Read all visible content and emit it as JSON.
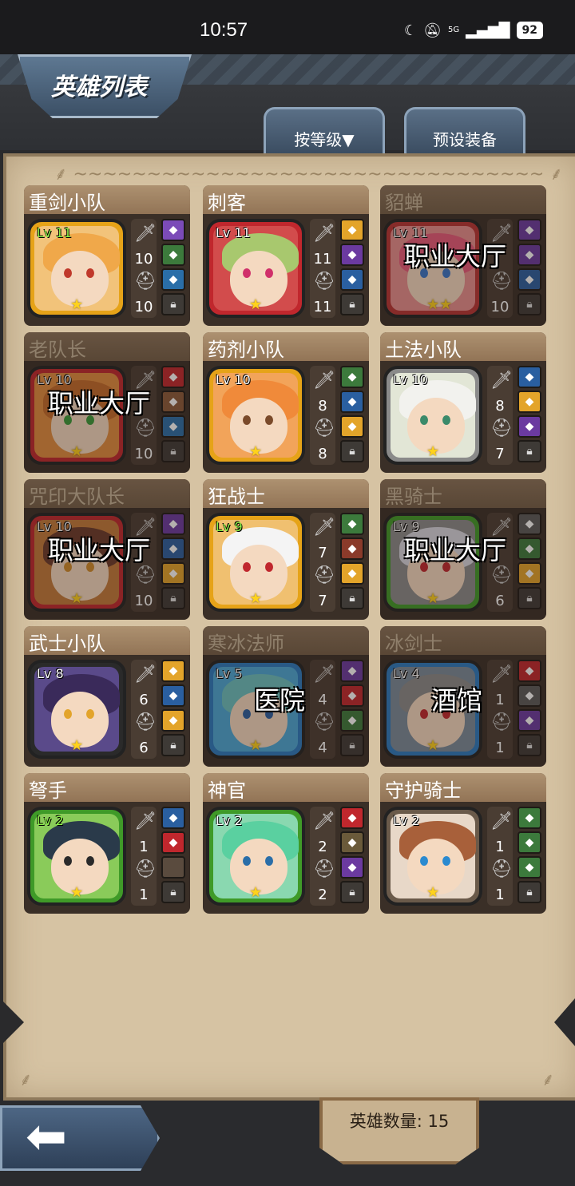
{
  "status_bar": {
    "time": "10:57",
    "battery": "92",
    "signal": "5G"
  },
  "title": "英雄列表",
  "tabs": {
    "sort": "按等级▼",
    "preset": "预设装备"
  },
  "hero_count": "英雄数量: 15",
  "heroes": [
    {
      "name": "重剑小队",
      "level": "Lv 11",
      "weapon": "10",
      "armor": "10",
      "stars": "★",
      "overlay": ""
    },
    {
      "name": "刺客",
      "level": "Lv 11",
      "weapon": "11",
      "armor": "11",
      "stars": "★",
      "overlay": ""
    },
    {
      "name": "貂蝉",
      "level": "Lv 11",
      "weapon": "",
      "armor": "10",
      "stars": "★★",
      "overlay": "职业大厅"
    },
    {
      "name": "老队长",
      "level": "Lv 10",
      "weapon": "",
      "armor": "10",
      "stars": "★",
      "overlay": "职业大厅"
    },
    {
      "name": "药剂小队",
      "level": "Lv 10",
      "weapon": "8",
      "armor": "8",
      "stars": "★",
      "overlay": ""
    },
    {
      "name": "土法小队",
      "level": "Lv 10",
      "weapon": "8",
      "armor": "7",
      "stars": "★",
      "overlay": ""
    },
    {
      "name": "咒印大队长",
      "level": "Lv 10",
      "weapon": "",
      "armor": "10",
      "stars": "★",
      "overlay": "职业大厅"
    },
    {
      "name": "狂战士",
      "level": "Lv 9",
      "weapon": "7",
      "armor": "7",
      "stars": "★",
      "overlay": ""
    },
    {
      "name": "黑骑士",
      "level": "Lv 9",
      "weapon": "",
      "armor": "6",
      "stars": "★",
      "overlay": "职业大厅"
    },
    {
      "name": "武士小队",
      "level": "Lv 8",
      "weapon": "6",
      "armor": "6",
      "stars": "★",
      "overlay": ""
    },
    {
      "name": "寒冰法师",
      "level": "Lv 5",
      "weapon": "4",
      "armor": "4",
      "stars": "★",
      "overlay": "医院"
    },
    {
      "name": "冰剑士",
      "level": "Lv 4",
      "weapon": "1",
      "armor": "1",
      "stars": "★",
      "overlay": "酒馆"
    },
    {
      "name": "弩手",
      "level": "Lv 2",
      "weapon": "1",
      "armor": "1",
      "stars": "★",
      "overlay": ""
    },
    {
      "name": "神官",
      "level": "Lv 2",
      "weapon": "2",
      "armor": "2",
      "stars": "★",
      "overlay": ""
    },
    {
      "name": "守护骑士",
      "level": "Lv 2",
      "weapon": "1",
      "armor": "1",
      "stars": "★",
      "overlay": ""
    }
  ],
  "icons": {
    "back": "back-arrow-icon",
    "weapon": "sword-icon",
    "armor": "helmet-icon",
    "lock": "lock-icon"
  }
}
